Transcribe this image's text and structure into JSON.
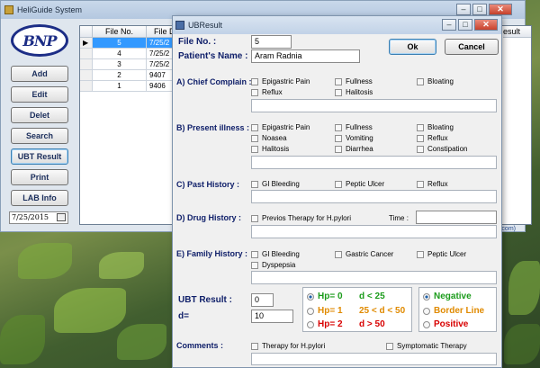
{
  "main_window": {
    "title": "HeliGuide System",
    "logo_text": "BNP",
    "sidebar": [
      "Add",
      "Edit",
      "Delet",
      "Search",
      "UBT Result",
      "Print",
      "LAB Info"
    ],
    "date": "7/25/2015",
    "grid": {
      "columns": [
        "File No.",
        "File D",
        "esult"
      ],
      "rows": [
        {
          "file_no": "5",
          "date": "7/25/2"
        },
        {
          "file_no": "4",
          "date": "7/25/2"
        },
        {
          "file_no": "3",
          "date": "7/25/2"
        },
        {
          "file_no": "2",
          "date": "9407"
        },
        {
          "file_no": "1",
          "date": "9406"
        }
      ],
      "footer_text": "sed.com)"
    },
    "window_buttons": {
      "minimize": "–",
      "maximize": "□",
      "close": "✕"
    }
  },
  "dialog": {
    "title": "UBResult",
    "window_buttons": {
      "minimize": "–",
      "maximize": "□",
      "close": "✕"
    },
    "file_no_label": "File No. :",
    "file_no_value": "5",
    "patient_label": "Patient's Name :",
    "patient_value": "Aram Radnia",
    "ok_label": "Ok",
    "cancel_label": "Cancel",
    "chief_label": "A) Chief Complain :",
    "chief_items": [
      "Epigastric Pain",
      "Fullness",
      "Bloating",
      "Reflux",
      "Halitosis"
    ],
    "present_label": "B) Present illness :",
    "present_items": [
      "Epigastric Pain",
      "Fullness",
      "Bloating",
      "Noasea",
      "Vomiting",
      "Reflux",
      "Halitosis",
      "Diarrhea",
      "Constipation"
    ],
    "past_label": "C) Past History :",
    "past_items": [
      "GI Bleeding",
      "Peptic Ulcer",
      "Reflux"
    ],
    "drug_label": "D) Drug History :",
    "drug_item": "Previos Therapy for H.pylori",
    "time_label": "Time :",
    "family_label": "E) Family History :",
    "family_items": [
      "GI Bleeding",
      "Gastric Cancer",
      "Peptic Ulcer",
      "Dyspepsia"
    ],
    "ubt_label": "UBT Result :",
    "ubt_value": "0",
    "d_label": "d=",
    "d_value": "10",
    "hp_options": [
      {
        "label": "Hp= 0",
        "range": "d < 25",
        "color": "#1a9b1a",
        "selected": true
      },
      {
        "label": "Hp= 1",
        "range": "25 < d < 50",
        "color": "#e08a00",
        "selected": false
      },
      {
        "label": "Hp= 2",
        "range": "d > 50",
        "color": "#d80000",
        "selected": false
      }
    ],
    "result_options": [
      {
        "label": "Negative",
        "color": "#1a9b1a",
        "selected": true
      },
      {
        "label": "Border Line",
        "color": "#e08a00",
        "selected": false
      },
      {
        "label": "Positive",
        "color": "#d80000",
        "selected": false
      }
    ],
    "comments_label": "Comments :",
    "comment_items": [
      "Therapy for H.pylori",
      "Symptomatic Therapy"
    ]
  }
}
